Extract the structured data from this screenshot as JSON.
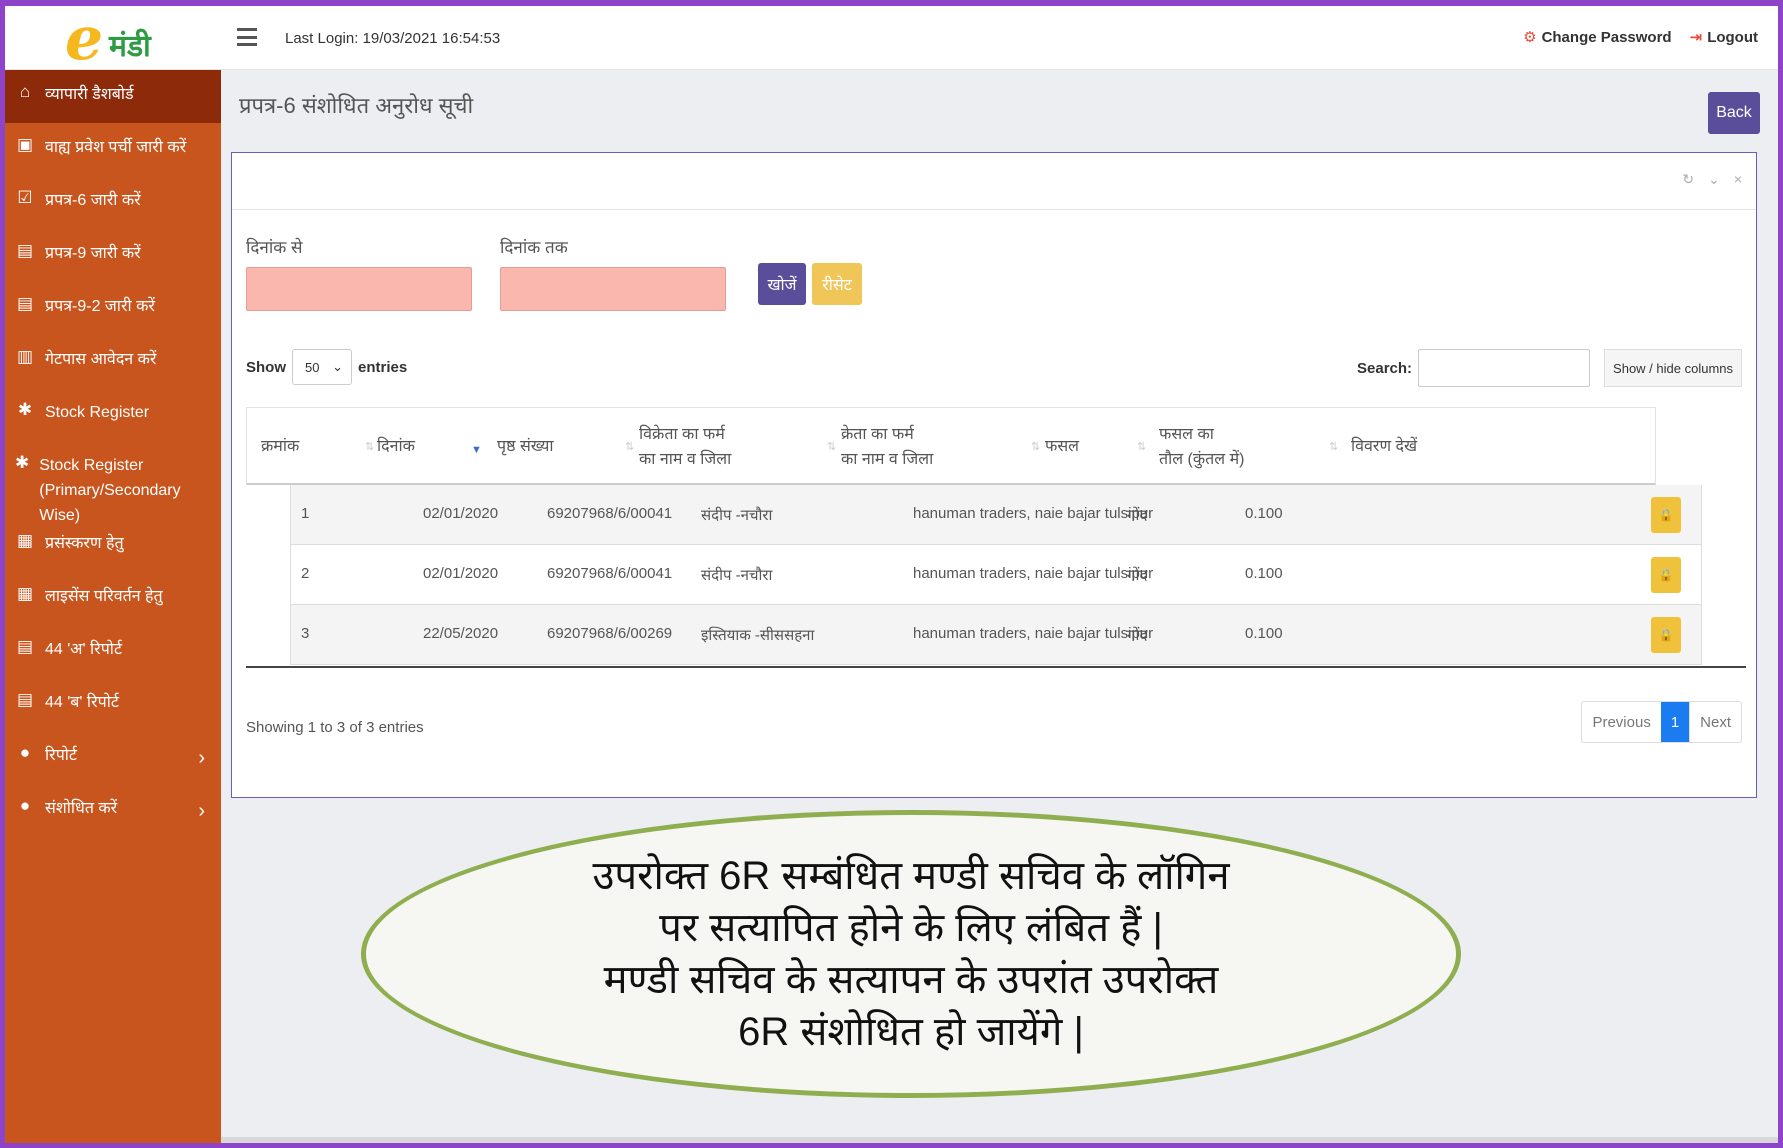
{
  "header": {
    "logo_letter": "e",
    "logo_text": "मंडी",
    "last_login": "Last Login: 19/03/2021 16:54:53",
    "change_password": "Change Password",
    "logout": "Logout"
  },
  "sidebar": {
    "items": [
      {
        "label": "व्यापारी डैशबोर्ड",
        "icon": "home-icon",
        "glyph": "⌂"
      },
      {
        "label": "वाह्य प्रवेश पर्ची जारी करें",
        "icon": "image-icon",
        "glyph": "▣"
      },
      {
        "label": "प्रपत्र-6 जारी करें",
        "icon": "checkbox-icon",
        "glyph": "☑"
      },
      {
        "label": "प्रपत्र-9 जारी करें",
        "icon": "file-icon",
        "glyph": "▤"
      },
      {
        "label": "प्रपत्र-9-2 जारी करें",
        "icon": "file-icon",
        "glyph": "▤"
      },
      {
        "label": "गेटपास आवेदन करें",
        "icon": "bar-chart-icon",
        "glyph": "▥"
      },
      {
        "label": "Stock Register",
        "icon": "snowflake-icon",
        "glyph": "✱"
      },
      {
        "label": "Stock Register (Primary/Secondary Wise)",
        "icon": "snowflake-icon",
        "glyph": "✱"
      },
      {
        "label": "प्रसंस्करण हेतु",
        "icon": "grid-icon",
        "glyph": "▦"
      },
      {
        "label": "लाइसेंस परिवर्तन हेतु",
        "icon": "grid-icon",
        "glyph": "▦"
      },
      {
        "label": "44 'अ' रिपोर्ट",
        "icon": "file-icon",
        "glyph": "▤"
      },
      {
        "label": "44 'ब' रिपोर्ट",
        "icon": "file-icon",
        "glyph": "▤"
      },
      {
        "label": "रिपोर्ट",
        "icon": "gear-icon",
        "glyph": "●"
      },
      {
        "label": "संशोधित करें",
        "icon": "gear-icon",
        "glyph": "●"
      }
    ]
  },
  "page": {
    "title": "प्रपत्र-6 संशोधित अनुरोध सूची",
    "back": "Back"
  },
  "filters": {
    "from_label": "दिनांक से",
    "to_label": "दिनांक तक",
    "search_btn": "खोजें",
    "reset_btn": "रीसेट"
  },
  "table_controls": {
    "show": "Show",
    "entries_value": "50",
    "entries": "entries",
    "search": "Search:",
    "show_hide": "Show / hide columns"
  },
  "table": {
    "headers": {
      "serial": "क्रमांक",
      "date": "दिनांक",
      "page_no": "पृष्ठ संख्या",
      "seller_1": "विक्रेता का फर्म",
      "seller_2": "का नाम व जिला",
      "buyer_1": "क्रेता का फर्म",
      "buyer_2": "का नाम व जिला",
      "crop": "फसल",
      "weight_1": "फसल का",
      "weight_2": "तौल (कुंतल में)",
      "details": "विवरण देखें"
    },
    "rows": [
      {
        "serial": "1",
        "date": "02/01/2020",
        "page_no": "69207968/6/00041",
        "seller": "संदीप -नचौरा",
        "buyer": "hanuman traders, naie bajar tulsipur",
        "crop": "गोंद",
        "weight": "0.100"
      },
      {
        "serial": "2",
        "date": "02/01/2020",
        "page_no": "69207968/6/00041",
        "seller": "संदीप -नचौरा",
        "buyer": "hanuman traders, naie bajar tulsipur",
        "crop": "गोंद",
        "weight": "0.100"
      },
      {
        "serial": "3",
        "date": "22/05/2020",
        "page_no": "69207968/6/00269",
        "seller": "इस्तियाक -सीससहना",
        "buyer": "hanuman traders, naie bajar tulsipur",
        "crop": "गोंद",
        "weight": "0.100"
      }
    ]
  },
  "footer": {
    "info": "Showing 1 to 3 of 3 entries",
    "previous": "Previous",
    "current_page": "1",
    "next": "Next"
  },
  "callout": {
    "line1": "उपरोक्त 6R सम्बंधित  मण्डी सचिव के लॉगिन",
    "line2": "पर सत्यापित होने के लिए लंबित हैं |",
    "line3": "मण्डी सचिव के सत्यापन के उपरांत उपरोक्त",
    "line4": "6R संशोधित हो जायेंगे |"
  },
  "colors": {
    "sidebar": "#c9551e",
    "sidebar_active": "#8c2a0a",
    "primary_btn": "#5a4d9a",
    "warning_btn": "#f0c659",
    "date_input": "#f9b7ae",
    "frame_border": "#8e44c9",
    "callout_border": "#8fae4f"
  }
}
